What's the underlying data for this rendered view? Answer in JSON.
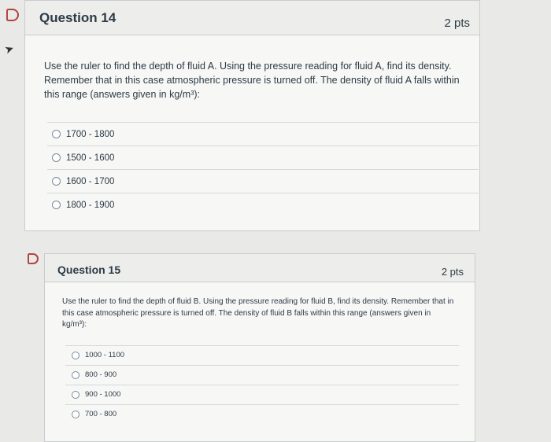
{
  "questions": [
    {
      "title": "Question 14",
      "points": "2 pts",
      "text": "Use the ruler to find the depth of fluid A. Using the pressure reading for fluid A, find its density. Remember that in this case atmospheric pressure is turned off. The density of fluid A falls within this range (answers given in kg/m³):",
      "answers": [
        "1700 - 1800",
        "1500 - 1600",
        "1600 - 1700",
        "1800 - 1900"
      ]
    },
    {
      "title": "Question 15",
      "points": "2 pts",
      "text": "Use the ruler to find the depth of fluid B. Using the pressure reading for fluid B, find its density. Remember that in this case atmospheric pressure is turned off. The density of fluid B falls within this range (answers given in kg/m³):",
      "answers": [
        "1000 - 1100",
        "800 - 900",
        "900 - 1000",
        "700 - 800"
      ]
    }
  ],
  "icons": {
    "flag": "flag-question-icon",
    "cursor": "cursor-arrow-icon"
  },
  "colors": {
    "flag": "#b14444",
    "panel": "#f7f7f6",
    "header": "#ededec"
  }
}
